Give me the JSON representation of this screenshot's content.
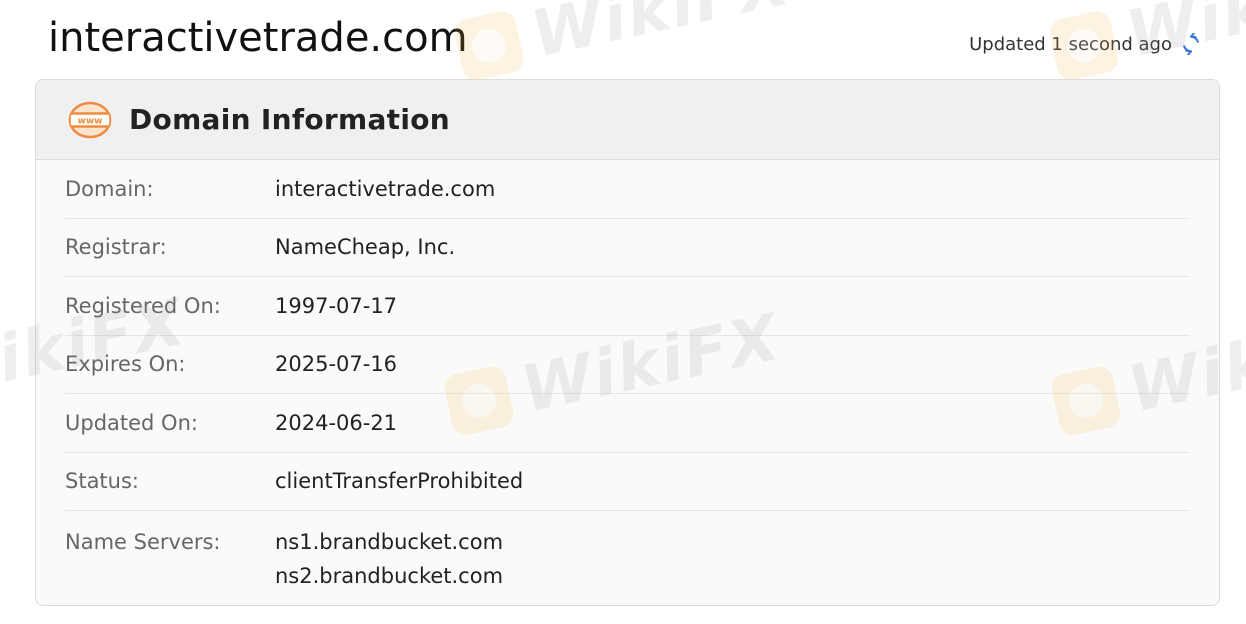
{
  "page": {
    "title": "interactivetrade.com",
    "updated_text": "Updated 1 second ago"
  },
  "card": {
    "title": "Domain Information",
    "icon_text": "www",
    "rows": [
      {
        "label": "Domain:",
        "value": "interactivetrade.com"
      },
      {
        "label": "Registrar:",
        "value": "NameCheap, Inc."
      },
      {
        "label": "Registered On:",
        "value": "1997-07-17"
      },
      {
        "label": "Expires On:",
        "value": "2025-07-16"
      },
      {
        "label": "Updated On:",
        "value": "2024-06-21"
      },
      {
        "label": "Status:",
        "value": "clientTransferProhibited"
      }
    ],
    "name_servers": {
      "label": "Name Servers:",
      "values": [
        "ns1.brandbucket.com",
        "ns2.brandbucket.com"
      ]
    }
  },
  "watermark": {
    "text": "WikiFX"
  },
  "colors": {
    "accent_orange": "#f08a3e",
    "refresh_blue": "#3a7bd5",
    "header_bg": "#f0f0f0",
    "label_gray": "#666666"
  },
  "icons": {
    "domain": "www-globe-icon",
    "refresh": "refresh-icon"
  }
}
